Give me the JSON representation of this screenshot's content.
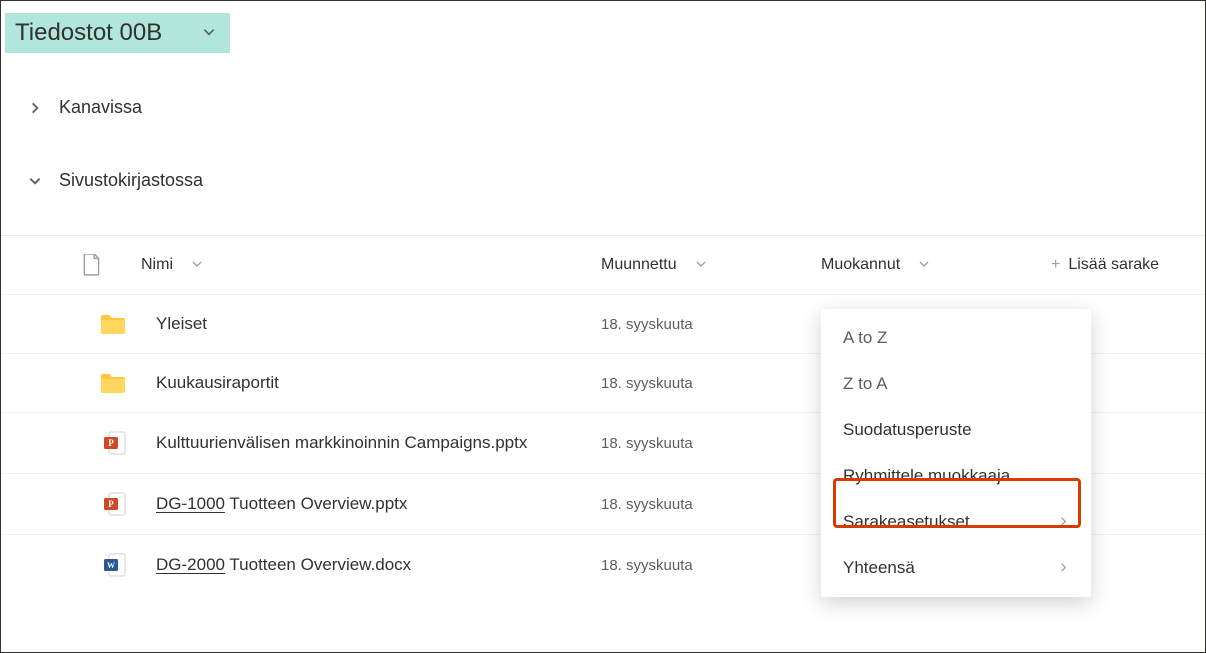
{
  "header": {
    "title": "Tiedostot 00B"
  },
  "sections": {
    "collapsed": "Kanavissa",
    "expanded": "Sivustokirjastossa"
  },
  "columns": {
    "name": "Nimi",
    "modified": "Muunnettu",
    "modifiedBy": "Muokannut",
    "add": "Lisää sarake"
  },
  "rows": [
    {
      "icon": "folder",
      "name": "Yleiset",
      "modified": "18. syyskuuta",
      "underline": false
    },
    {
      "icon": "folder",
      "name": "Kuukausiraportit",
      "modified": "18. syyskuuta",
      "underline": false
    },
    {
      "icon": "pptx",
      "name": "Kulttuurienvälisen markkinoinnin Campaigns.pptx",
      "modified": "18. syyskuuta",
      "underline": false
    },
    {
      "icon": "pptx",
      "prefix": "DG-1000",
      "name": "Tuotteen Overview.pptx",
      "modified": "18. syyskuuta",
      "underline": true
    },
    {
      "icon": "docx",
      "prefix": "DG-2000",
      "name": "Tuotteen Overview.docx",
      "modified": "18. syyskuuta",
      "underline": true
    }
  ],
  "menu": {
    "atoz": "A to Z",
    "ztoa": "Z to A",
    "filter": "Suodatusperuste",
    "group": "Ryhmittele muokkaaja",
    "columnSettings": "Sarakeasetukset",
    "total": "Yhteensä"
  }
}
